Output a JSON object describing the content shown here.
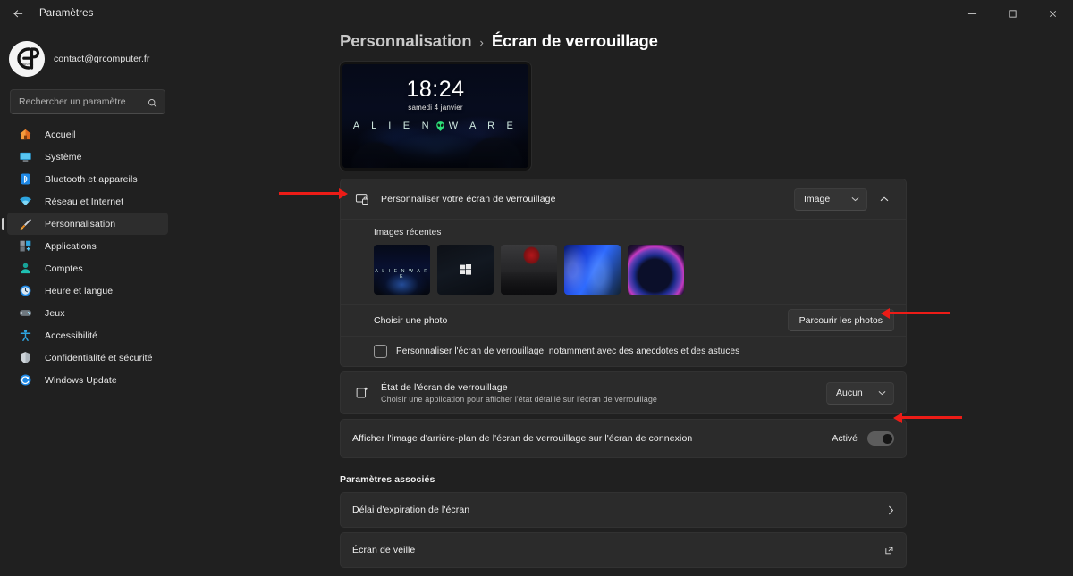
{
  "titlebar": {
    "back_label": "back-arrow",
    "title": "Paramètres",
    "minimize": "─",
    "maximize": "❐",
    "close": "✕"
  },
  "sidebar": {
    "account_email": "contact@grcomputer.fr",
    "search_placeholder": "Rechercher un paramètre",
    "search_value": "",
    "items": [
      {
        "label": "Accueil",
        "icon": "home-icon",
        "selected": false
      },
      {
        "label": "Système",
        "icon": "system-icon",
        "selected": false
      },
      {
        "label": "Bluetooth et appareils",
        "icon": "bluetooth-icon",
        "selected": false
      },
      {
        "label": "Réseau et Internet",
        "icon": "network-icon",
        "selected": false
      },
      {
        "label": "Personnalisation",
        "icon": "brush-icon",
        "selected": true
      },
      {
        "label": "Applications",
        "icon": "apps-icon",
        "selected": false
      },
      {
        "label": "Comptes",
        "icon": "accounts-icon",
        "selected": false
      },
      {
        "label": "Heure et langue",
        "icon": "time-icon",
        "selected": false
      },
      {
        "label": "Jeux",
        "icon": "gaming-icon",
        "selected": false
      },
      {
        "label": "Accessibilité",
        "icon": "accessibility-icon",
        "selected": false
      },
      {
        "label": "Confidentialité et sécurité",
        "icon": "shield-icon",
        "selected": false
      },
      {
        "label": "Windows Update",
        "icon": "update-icon",
        "selected": false
      }
    ]
  },
  "breadcrumb": {
    "parent": "Personnalisation",
    "separator": "›",
    "current": "Écran de verrouillage"
  },
  "preview": {
    "time": "18:24",
    "date": "samedi 4 janvier",
    "brand_left": "A L I E N",
    "brand_right": "W A R E"
  },
  "personalize_card": {
    "icon": "lockscreen-icon",
    "title": "Personnaliser votre écran de verrouillage",
    "dropdown_value": "Image",
    "dropdown_chevron": "⌄",
    "expander_chevron": "⌃",
    "recent_label": "Images récentes",
    "thumbnails": [
      {
        "name": "alienware-wallpaper",
        "caption": "A L I E N  W A R E"
      },
      {
        "name": "windows-logo-wallpaper",
        "caption": ""
      },
      {
        "name": "red-flag-wallpaper",
        "caption": ""
      },
      {
        "name": "blue-bloom-wallpaper",
        "caption": ""
      },
      {
        "name": "purple-arc-wallpaper",
        "caption": ""
      }
    ],
    "choose_label": "Choisir une photo",
    "browse_button": "Parcourir les photos",
    "checkbox_label": "Personnaliser l'écran de verrouillage, notamment avec des anecdotes et des astuces",
    "checkbox_checked": false
  },
  "status_card": {
    "icon": "status-icon",
    "title": "État de l'écran de verrouillage",
    "subtitle": "Choisir une application pour afficher l'état détaillé sur l'écran de verrouillage",
    "dropdown_value": "Aucun",
    "dropdown_chevron": "⌄"
  },
  "signin_card": {
    "label": "Afficher l'image d'arrière-plan de l'écran de verrouillage sur l'écran de connexion",
    "state": "Activé",
    "toggle_on": true
  },
  "related": {
    "heading": "Paramètres associés",
    "rows": [
      {
        "label": "Délai d'expiration de l'écran",
        "icon": "chevron-right-icon",
        "glyph": "›"
      },
      {
        "label": "Écran de veille",
        "icon": "external-link-icon",
        "glyph": "↗"
      }
    ]
  },
  "annotations": {
    "arrows": [
      {
        "name": "arrow-to-personalize-row",
        "direction": "right"
      },
      {
        "name": "arrow-to-browse-photos",
        "direction": "left"
      },
      {
        "name": "arrow-to-signin-toggle",
        "direction": "left"
      }
    ],
    "color": "#ec1c17"
  }
}
